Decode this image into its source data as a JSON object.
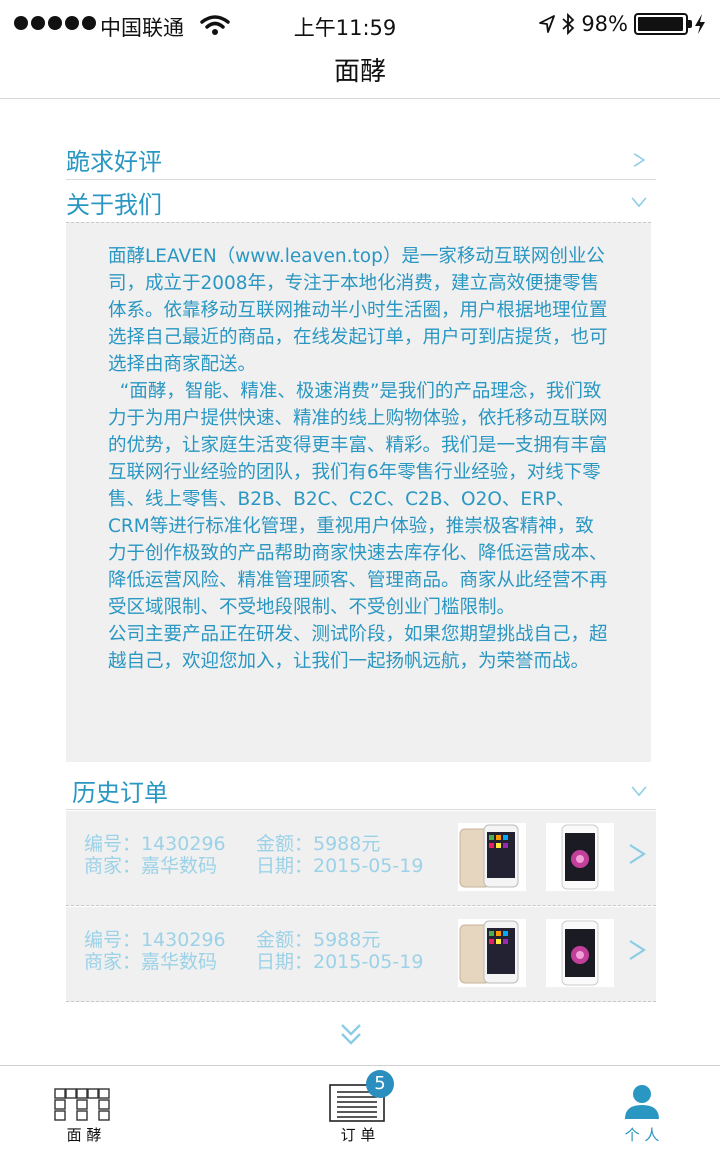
{
  "status_bar": {
    "carrier": "中国联通",
    "time": "上午11:59",
    "battery_text": "98%",
    "battery_level": 0.98
  },
  "nav": {
    "title": "面酵"
  },
  "sections": {
    "review": {
      "label": "跪求好评"
    },
    "about": {
      "label": "关于我们",
      "text": "面酵LEAVEN（www.leaven.top）是一家移动互联网创业公司，成立于2008年，专注于本地化消费，建立高效便捷零售体系。依靠移动互联网推动半小时生活圈，用户根据地理位置选择自己最近的商品，在线发起订单，用户可到店提货，也可选择由商家配送。\n  “面酵，智能、精准、极速消费”是我们的产品理念，我们致力于为用户提供快速、精准的线上购物体验，依托移动互联网的优势，让家庭生活变得更丰富、精彩。我们是一支拥有丰富互联网行业经验的团队，我们有6年零售行业经验，对线下零售、线上零售、B2B、B2C、C2C、C2B、O2O、ERP、CRM等进行标准化管理，重视用户体验，推崇极客精神，致力于创作极致的产品帮助商家快速去库存化、降低运营成本、降低运营风险、精准管理顾客、管理商品。商家从此经营不再受区域限制、不受地段限制、不受创业门槛限制。\n公司主要产品正在研发、测试阶段，如果您期望挑战自己，超越自己，欢迎您加入，让我们一起扬帆远航，为荣誉而战。"
    },
    "history": {
      "label": "历史订单"
    }
  },
  "orders": [
    {
      "number_label": "编号：1430296",
      "merchant_label": "商家：嘉华数码",
      "amount_label": "金额：5988元",
      "date_label": "日期：2015-05-19"
    },
    {
      "number_label": "编号：1430296",
      "merchant_label": "商家：嘉华数码",
      "amount_label": "金额：5988元",
      "date_label": "日期：2015-05-19"
    }
  ],
  "tabs": [
    {
      "label": "面 酵",
      "icon": "grid-icon"
    },
    {
      "label": "订 单",
      "icon": "order-list-icon",
      "badge": "5"
    },
    {
      "label": "个 人",
      "icon": "person-icon",
      "active": true
    }
  ],
  "colors": {
    "accent": "#2a97c2",
    "light_accent": "#9cd2e8",
    "panel_bg": "#f0f0f0"
  }
}
